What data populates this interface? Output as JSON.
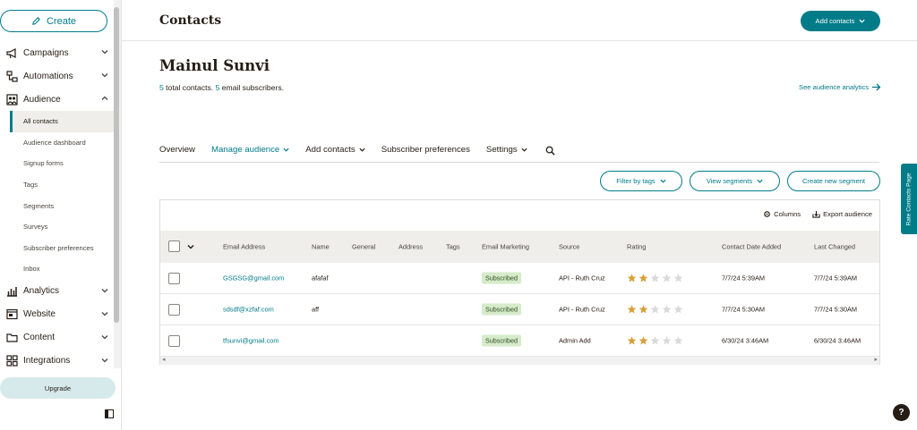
{
  "sidebar": {
    "create_label": "Create",
    "items": [
      {
        "label": "Campaigns",
        "icon": "megaphone-icon",
        "chev": "down"
      },
      {
        "label": "Automations",
        "icon": "flow-icon",
        "chev": "down"
      },
      {
        "label": "Audience",
        "icon": "people-icon",
        "chev": "up"
      }
    ],
    "sub_items": [
      "All contacts",
      "Audience dashboard",
      "Signup forms",
      "Tags",
      "Segments",
      "Surveys",
      "Subscriber preferences",
      "Inbox"
    ],
    "items_after": [
      {
        "label": "Analytics",
        "icon": "chart-icon",
        "chev": "down"
      },
      {
        "label": "Website",
        "icon": "browser-icon",
        "chev": "down"
      },
      {
        "label": "Content",
        "icon": "folder-icon",
        "chev": "down"
      },
      {
        "label": "Integrations",
        "icon": "grid-icon",
        "chev": "down"
      }
    ],
    "upgrade_label": "Upgrade"
  },
  "header": {
    "title": "Contacts",
    "add_contacts_label": "Add contacts"
  },
  "audience": {
    "name": "Mainul Sunvi",
    "total_count": "5",
    "total_text": " total contacts. ",
    "email_count": "5",
    "email_text": " email subscribers.",
    "analytics_link": "See audience analytics"
  },
  "tabs": [
    {
      "label": "Overview",
      "dropdown": false,
      "active": false
    },
    {
      "label": "Manage audience",
      "dropdown": true,
      "active": true
    },
    {
      "label": "Add contacts",
      "dropdown": true,
      "active": false
    },
    {
      "label": "Subscriber preferences",
      "dropdown": false,
      "active": false
    },
    {
      "label": "Settings",
      "dropdown": true,
      "active": false
    }
  ],
  "segment_buttons": {
    "filter": "Filter by tags",
    "view": "View segments",
    "create": "Create new segment"
  },
  "table": {
    "columns_label": "Columns",
    "export_label": "Export audience",
    "headers": [
      "Email Address",
      "Name",
      "General",
      "Address",
      "Tags",
      "Email Marketing",
      "Source",
      "Rating",
      "Contact Date Added",
      "Last Changed"
    ],
    "rows": [
      {
        "email": "GSGSG@gmail.com",
        "name": "afafaf",
        "status": "Subscribed",
        "source": "API - Ruth Cruz",
        "rating": 2,
        "added": "7/7/24 5:39AM",
        "changed": "7/7/24 5:39AM"
      },
      {
        "email": "sdsdf@xzfaf.com",
        "name": "aff",
        "status": "Subscribed",
        "source": "API - Ruth Cruz",
        "rating": 2,
        "added": "7/7/24 5:30AM",
        "changed": "7/7/24 5:30AM"
      },
      {
        "email": "tfsunvi@gmail.com",
        "name": "",
        "status": "Subscribed",
        "source": "Admin Add",
        "rating": 2,
        "added": "6/30/24 3:46AM",
        "changed": "6/30/24 3:46AM"
      }
    ]
  },
  "rate_tab_label": "Rate Contacts Page",
  "help_label": "?",
  "colors": {
    "accent": "#007c89",
    "star_filled": "#d8a03a",
    "star_empty": "#d9d9d9",
    "badge": "#d5ebc9"
  }
}
